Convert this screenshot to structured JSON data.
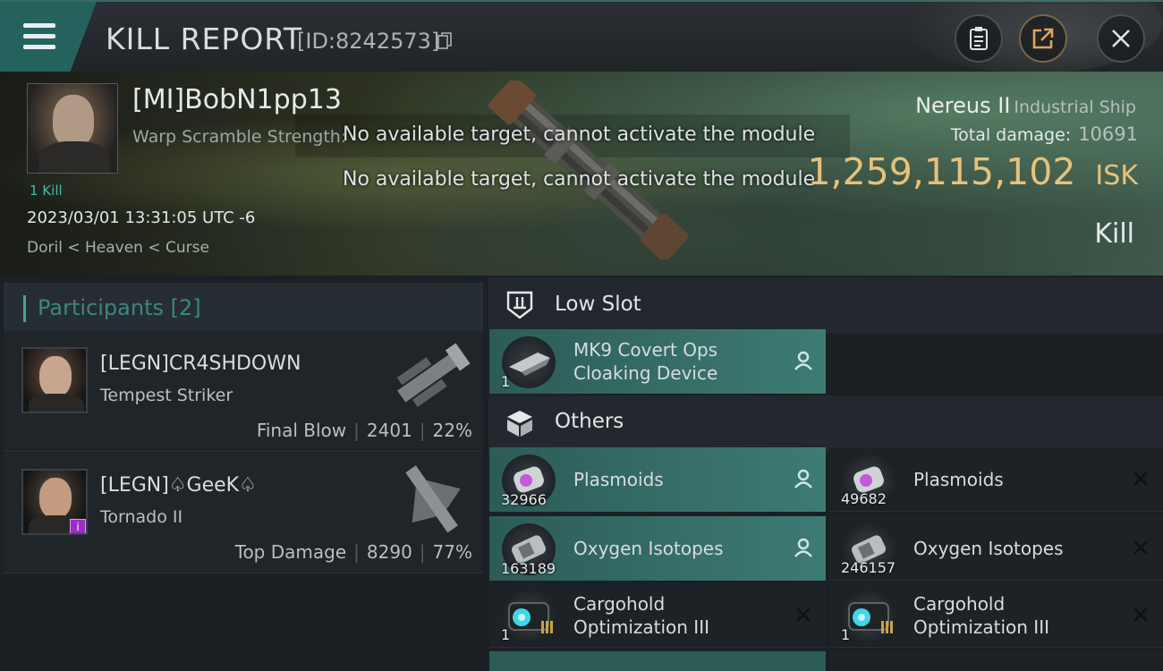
{
  "header": {
    "title": "KILL REPORT",
    "report_id": "[ID:8242573]",
    "buttons": [
      "clipboard-icon",
      "share-icon",
      "close-icon"
    ]
  },
  "victim": {
    "name": "[MI]BobN1pp13",
    "warp_label": "Warp Scramble Strength:",
    "kill_count": "1 Kill",
    "time": "2023/03/01 13:31:05 UTC -6",
    "location": "Doril < Heaven < Curse",
    "ship_name": "Nereus II",
    "ship_class": "Industrial Ship",
    "total_damage_label": "Total damage:",
    "total_damage": "10691",
    "isk_value": "1,259,115,102",
    "isk_unit": "ISK",
    "kill_type": "Kill"
  },
  "notifications": [
    "No available target, cannot activate the module",
    "No available target, cannot activate the module"
  ],
  "participants": {
    "title": "Participants",
    "count": "[2]",
    "rows": [
      {
        "name": "[LEGN]CR4SHDOWN",
        "ship": "Tempest Striker",
        "role": "Final Blow",
        "damage": "2401",
        "percent": "22%"
      },
      {
        "name": "[LEGN]♤GeeK♤",
        "ship": "Tornado II",
        "role": "Top Damage",
        "damage": "8290",
        "percent": "77%"
      }
    ]
  },
  "fitting": {
    "low_slot_title": "Low Slot",
    "others_title": "Others",
    "low_slot_items": [
      {
        "name_line1": "MK9 Covert Ops",
        "name_line2": "Cloaking Device",
        "qty": "1",
        "status": "dropped"
      }
    ],
    "others_items": [
      {
        "name": "Plasmoids",
        "qty": "32966",
        "status": "dropped"
      },
      {
        "name": "Plasmoids",
        "qty": "49682",
        "status": "destroyed"
      },
      {
        "name": "Oxygen Isotopes",
        "qty": "163189",
        "status": "dropped"
      },
      {
        "name": "Oxygen Isotopes",
        "qty": "246157",
        "status": "destroyed"
      },
      {
        "name_line1": "Cargohold",
        "name_line2": "Optimization III",
        "qty": "1",
        "status": "destroyed"
      },
      {
        "name_line1": "Cargohold",
        "name_line2": "Optimization III",
        "qty": "1",
        "status": "destroyed"
      }
    ]
  },
  "colors": {
    "accent": "#3fa89b",
    "dropped": "#3e7b74",
    "isk": "#e6c27a",
    "header_tab": "#25625d"
  }
}
